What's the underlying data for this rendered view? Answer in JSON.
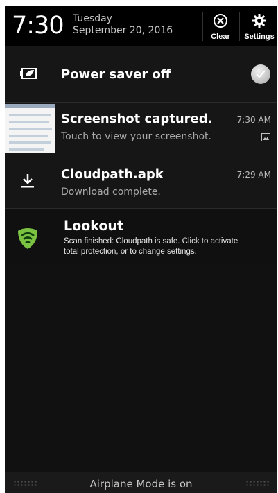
{
  "header": {
    "time": "7:30",
    "day": "Tuesday",
    "date": "September 20, 2016",
    "clear_label": "Clear",
    "settings_label": "Settings"
  },
  "notifications": [
    {
      "title": "Power saver off",
      "icon": "battery-leaf-icon",
      "toggle_on": false
    },
    {
      "title": "Screenshot captured.",
      "subtitle": "Touch to view your screenshot.",
      "time": "7:30 AM",
      "icon": "screenshot-thumbnail",
      "badge": "image-icon"
    },
    {
      "title": "Cloudpath.apk",
      "subtitle": "Download complete.",
      "time": "7:29 AM",
      "icon": "download-icon"
    },
    {
      "title": "Lookout",
      "subtitle_line1": "Scan finished: Cloudpath is safe. Click to activate",
      "subtitle_line2": "total protection, or to change settings.",
      "icon": "lookout-shield-icon"
    }
  ],
  "bottom_bar": {
    "status_text": "Airplane Mode is on"
  },
  "colors": {
    "background": "#111111",
    "header": "#000000",
    "lookout_green": "#7cc242"
  }
}
